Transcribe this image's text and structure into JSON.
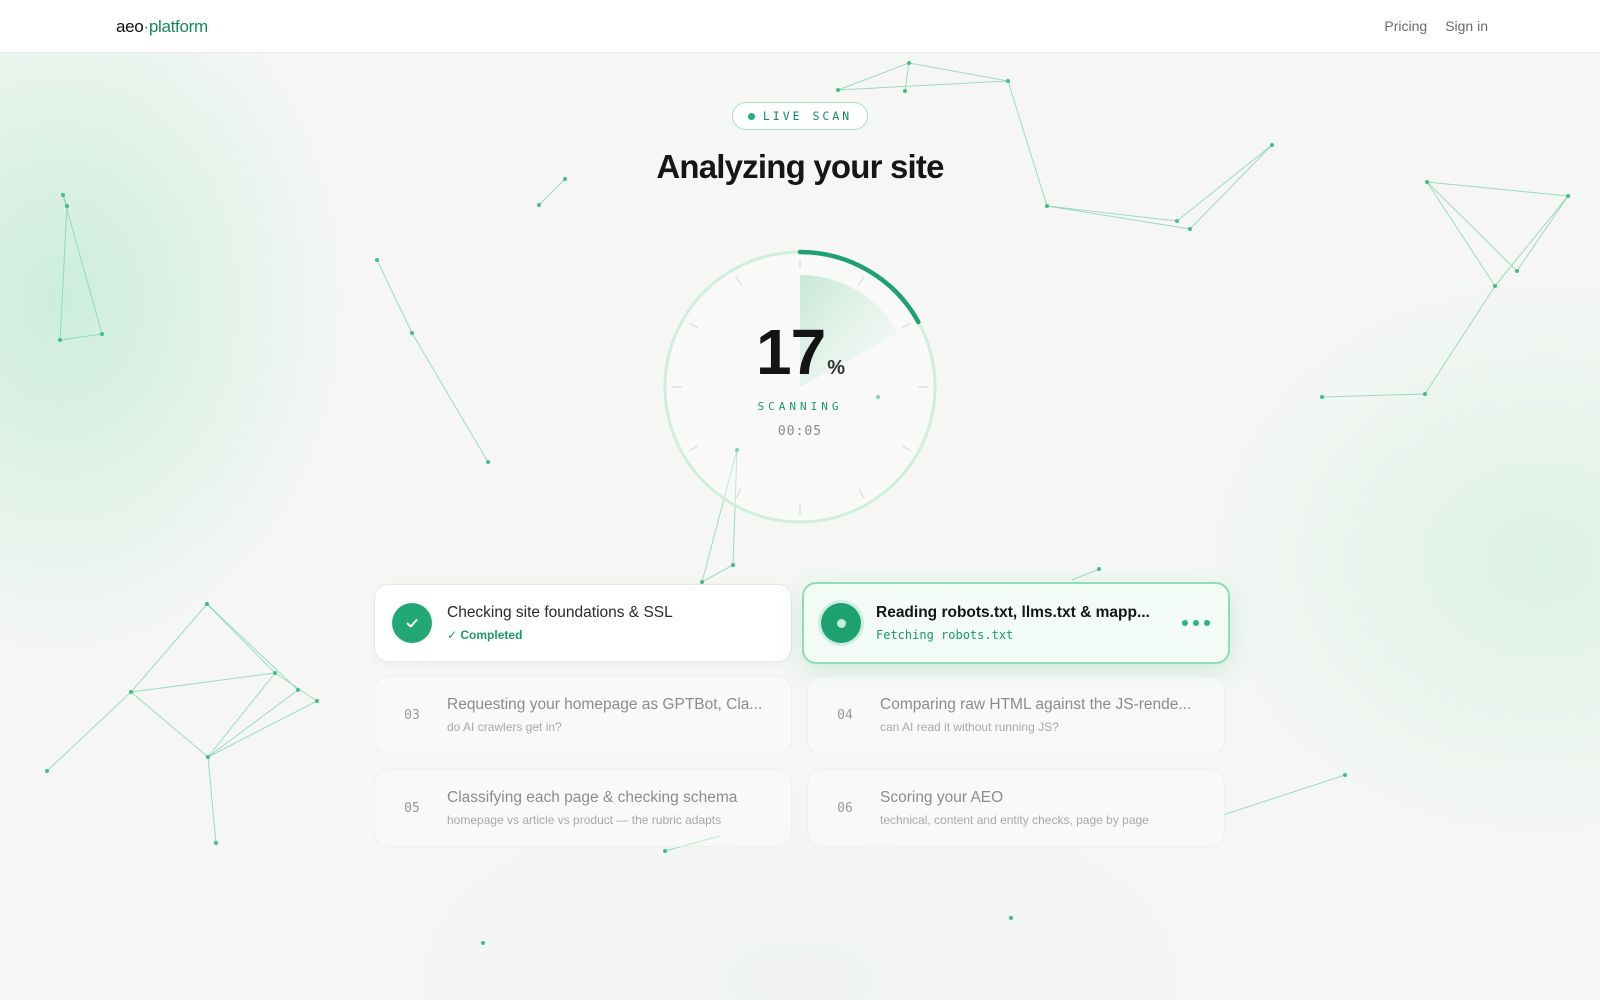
{
  "header": {
    "logo_main": "aeo",
    "logo_accent": "·platform",
    "nav": [
      "Pricing",
      "Sign in"
    ]
  },
  "badge": {
    "label": "LIVE SCAN"
  },
  "page_title": "Analyzing your site",
  "progress": {
    "value": "17",
    "unit": "%",
    "percent": 17,
    "status": "SCANNING",
    "elapsed": "00:05"
  },
  "steps": [
    {
      "state": "completed",
      "title": "Checking site foundations & SSL",
      "subtitle": "✓ Completed"
    },
    {
      "state": "active",
      "title": "Reading robots.txt, llms.txt & mapp...",
      "subtitle": "Fetching robots.txt"
    },
    {
      "state": "pending",
      "number": "03",
      "title": "Requesting your homepage as GPTBot, Cla...",
      "subtitle": "do AI crawlers get in?"
    },
    {
      "state": "pending",
      "number": "04",
      "title": "Comparing raw HTML against the JS-rende...",
      "subtitle": "can AI read it without running JS?"
    },
    {
      "state": "pending",
      "number": "05",
      "title": "Classifying each page & checking schema",
      "subtitle": "homepage vs article vs product — the rubric adapts"
    },
    {
      "state": "pending",
      "number": "06",
      "title": "Scoring your AEO",
      "subtitle": "technical, content and entity checks, page by page"
    }
  ],
  "colors": {
    "accent": "#1fae77",
    "accent_dark": "#138a5c",
    "network_line": "#7fd1ae"
  }
}
